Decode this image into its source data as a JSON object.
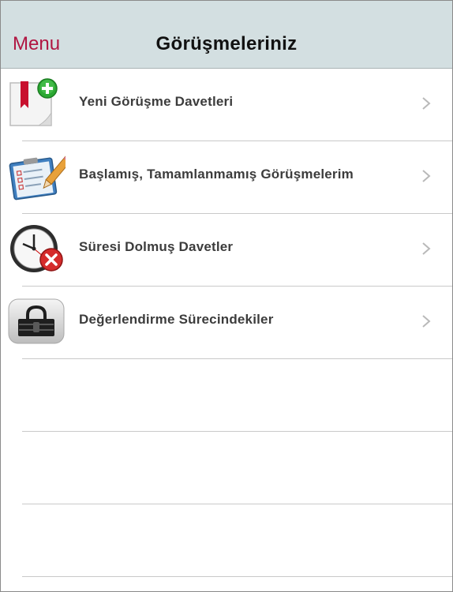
{
  "navbar": {
    "menu_label": "Menu",
    "title": "Görüşmeleriniz",
    "background": "#d3dfe1",
    "accent": "#b01642"
  },
  "list": {
    "items": [
      {
        "label": "Yeni Görüşme Davetleri",
        "icon": "new-invitation-icon"
      },
      {
        "label": "Başlamış, Tamamlanmamış Görüşmelerim",
        "icon": "clipboard-pencil-icon"
      },
      {
        "label": "Süresi Dolmuş Davetler",
        "icon": "clock-expired-icon"
      },
      {
        "label": "Değerlendirme Sürecindekiler",
        "icon": "lock-icon"
      }
    ]
  }
}
